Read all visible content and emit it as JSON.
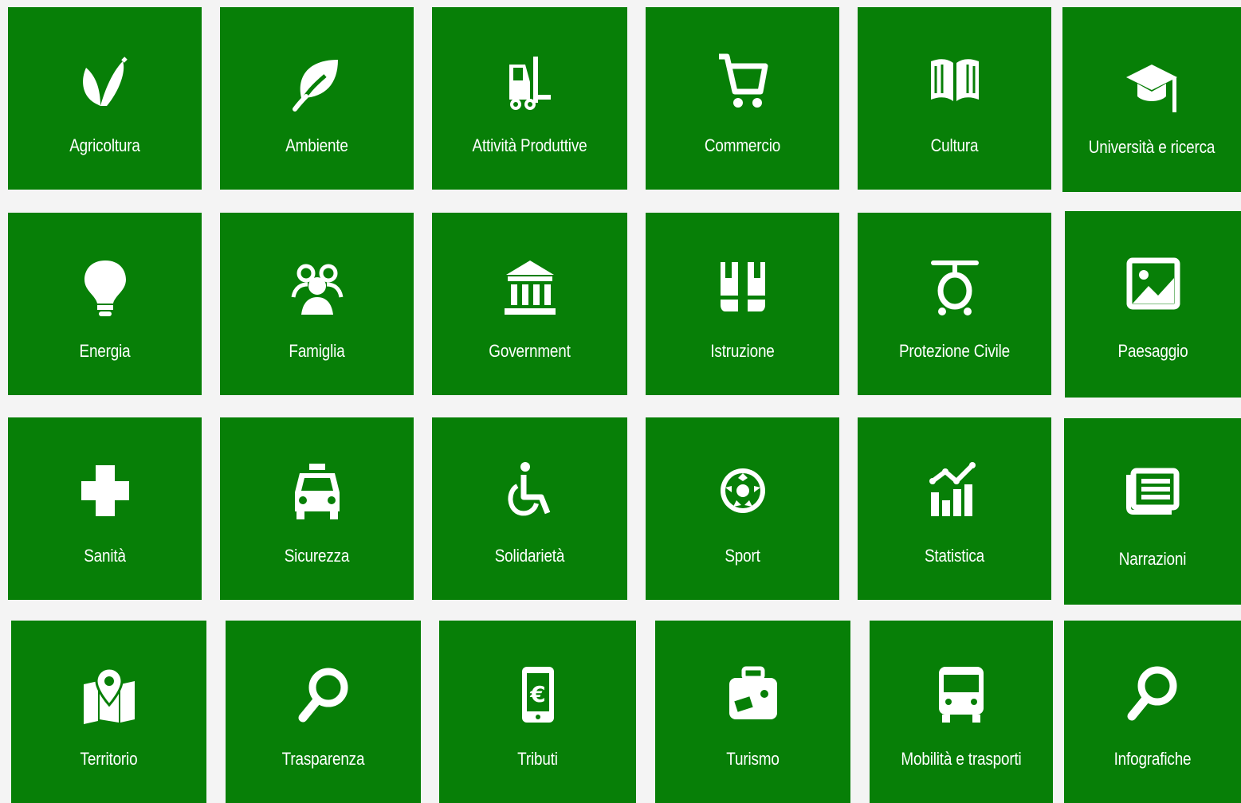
{
  "colors": {
    "tile_bg": "#077f07",
    "tile_fg": "#ffffff",
    "page_bg": "#f4f4f4"
  },
  "tiles": [
    {
      "label": "Agricoltura",
      "icon": "sprout-icon"
    },
    {
      "label": "Ambiente",
      "icon": "leaf-icon"
    },
    {
      "label": "Attività Produttive",
      "icon": "forklift-icon"
    },
    {
      "label": "Commercio",
      "icon": "shopping-cart-icon"
    },
    {
      "label": "Cultura",
      "icon": "open-book-icon"
    },
    {
      "label": "Università e ricerca",
      "icon": "graduation-cap-icon"
    },
    {
      "label": "Energia",
      "icon": "light-bulb-icon"
    },
    {
      "label": "Famiglia",
      "icon": "people-icon"
    },
    {
      "label": "Government",
      "icon": "institution-icon"
    },
    {
      "label": "Istruzione",
      "icon": "backpack-icon"
    },
    {
      "label": "Protezione Civile",
      "icon": "helicopter-icon"
    },
    {
      "label": "Paesaggio",
      "icon": "image-icon"
    },
    {
      "label": "Sanità",
      "icon": "medical-cross-icon"
    },
    {
      "label": "Sicurezza",
      "icon": "taxi-icon"
    },
    {
      "label": "Solidarietà",
      "icon": "wheelchair-icon"
    },
    {
      "label": "Sport",
      "icon": "soccer-ball-icon"
    },
    {
      "label": "Statistica",
      "icon": "chart-icon"
    },
    {
      "label": "Narrazioni",
      "icon": "newspaper-icon"
    },
    {
      "label": "Territorio",
      "icon": "map-marker-icon"
    },
    {
      "label": "Trasparenza",
      "icon": "magnifier-icon"
    },
    {
      "label": "Tributi",
      "icon": "mobile-euro-icon"
    },
    {
      "label": "Turismo",
      "icon": "suitcase-icon"
    },
    {
      "label": "Mobilità e trasporti",
      "icon": "bus-icon"
    },
    {
      "label": "Infografiche",
      "icon": "magnifier-icon"
    }
  ]
}
